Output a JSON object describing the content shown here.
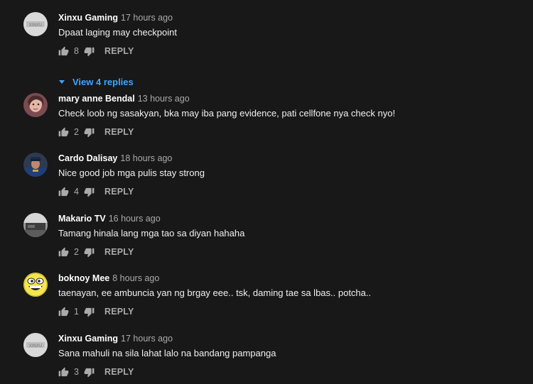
{
  "comments": [
    {
      "author": "Xinxu Gaming",
      "time": "17 hours ago",
      "text": "Dpaat laging may checkpoint",
      "likes": "8",
      "reply_label": "REPLY",
      "avatar": "xinxu-avatar"
    },
    {
      "author": "mary anne Bendal",
      "time": "13 hours ago",
      "text": "Check loob ng sasakyan, bka may iba pang evidence, pati cellfone nya check nyo!",
      "likes": "2",
      "reply_label": "REPLY",
      "avatar": "mary-avatar"
    },
    {
      "author": "Cardo Dalisay",
      "time": "18 hours ago",
      "text": "Nice good job mga pulis stay strong",
      "likes": "4",
      "reply_label": "REPLY",
      "avatar": "cardo-avatar"
    },
    {
      "author": "Makario TV",
      "time": "16 hours ago",
      "text": "Tamang hinala lang mga tao sa diyan hahaha",
      "likes": "2",
      "reply_label": "REPLY",
      "avatar": "makario-avatar"
    },
    {
      "author": "boknoy Mee",
      "time": "8 hours ago",
      "text": "taenayan, ee ambuncia yan ng brgay eee.. tsk, daming tae sa lbas.. potcha..",
      "likes": "1",
      "reply_label": "REPLY",
      "avatar": "boknoy-avatar"
    },
    {
      "author": "Xinxu Gaming",
      "time": "17 hours ago",
      "text": "Sana mahuli na sila lahat lalo na bandang pampanga",
      "likes": "3",
      "reply_label": "REPLY",
      "avatar": "xinxu-avatar"
    }
  ],
  "view_replies_label": "View 4 replies",
  "colors": {
    "background": "#181818",
    "link": "#3ea6ff",
    "meta": "#aaaaaa"
  }
}
